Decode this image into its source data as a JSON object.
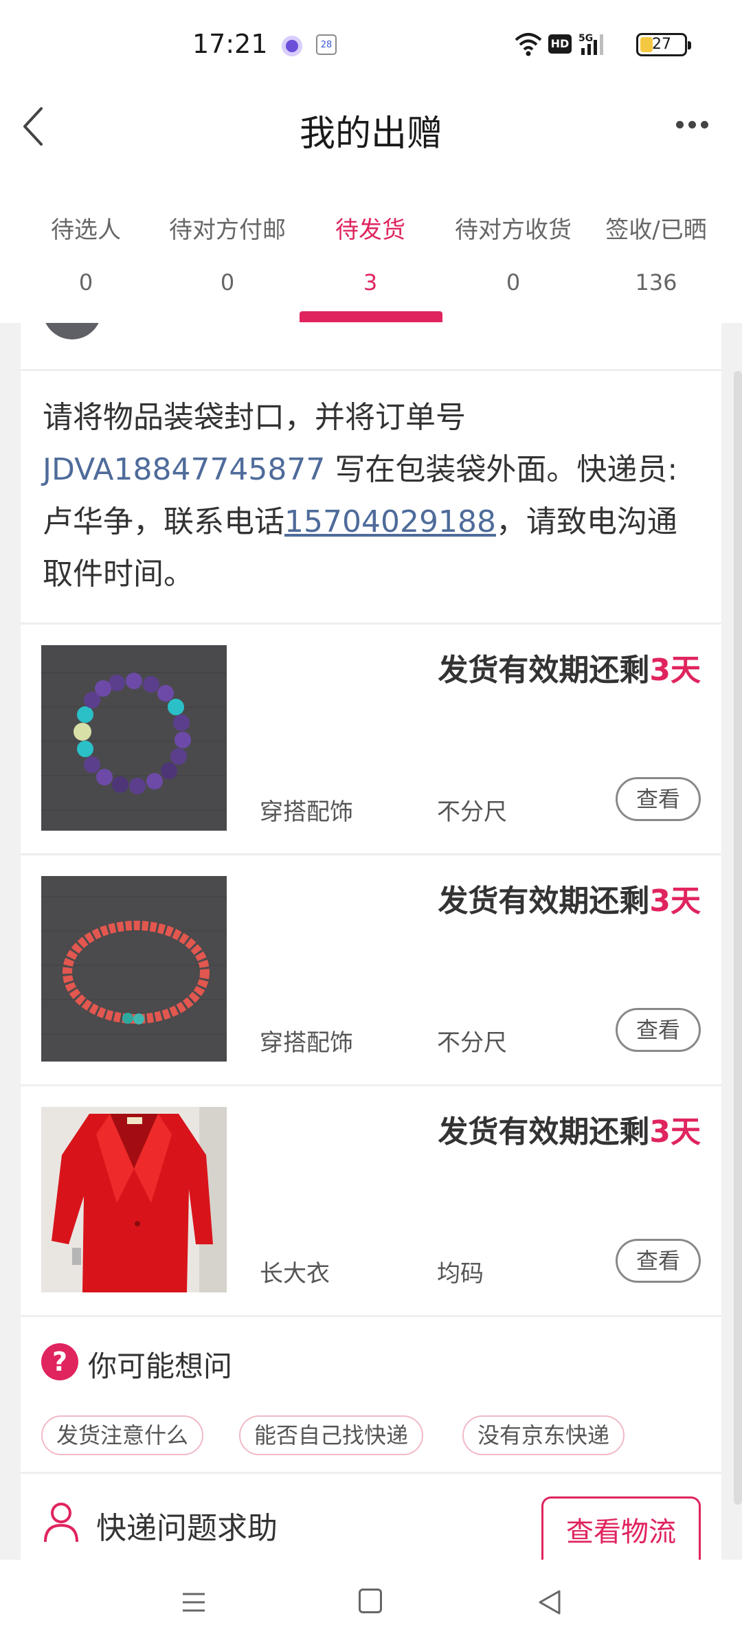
{
  "status_bar": {
    "time": "17:21",
    "calendar_day": "28",
    "battery_level": "27",
    "battery_fraction": 0.27,
    "network": "5G",
    "hd": "HD"
  },
  "nav": {
    "title": "我的出赠"
  },
  "tabs": [
    {
      "label": "待选人",
      "count": "0"
    },
    {
      "label": "待对方付邮",
      "count": "0"
    },
    {
      "label": "待发货",
      "count": "3"
    },
    {
      "label": "待对方收货",
      "count": "0"
    },
    {
      "label": "签收/已晒",
      "count": "136"
    }
  ],
  "active_tab": "待发货",
  "instructions": {
    "prefix": "请将物品装袋封口，并将订单号 ",
    "order_number": "JDVA18847745877",
    "middle": " 写在包装袋外面。快递员:卢华争，联系电话",
    "phone": "15704029188",
    "suffix": "，请致电沟通取件时间。"
  },
  "items": [
    {
      "deadline_prefix": "发货有效期还剩",
      "deadline_days": "3天",
      "category": "穿搭配饰",
      "size": "不分尺",
      "view_label": "查看",
      "photo": "purple-bracelet"
    },
    {
      "deadline_prefix": "发货有效期还剩",
      "deadline_days": "3天",
      "category": "穿搭配饰",
      "size": "不分尺",
      "view_label": "查看",
      "photo": "red-bracelet"
    },
    {
      "deadline_prefix": "发货有效期还剩",
      "deadline_days": "3天",
      "category": "长大衣",
      "size": "均码",
      "view_label": "查看",
      "photo": "red-coat"
    }
  ],
  "faq": {
    "title": "你可能想问",
    "chips": [
      "发货注意什么",
      "能否自己找快递",
      "没有京东快递"
    ]
  },
  "help": {
    "label": "快递问题求助",
    "logistics_button": "查看物流"
  },
  "colors": {
    "accent": "#e0245e",
    "link": "#4e6b9a",
    "text": "#333333",
    "muted": "#666666"
  }
}
